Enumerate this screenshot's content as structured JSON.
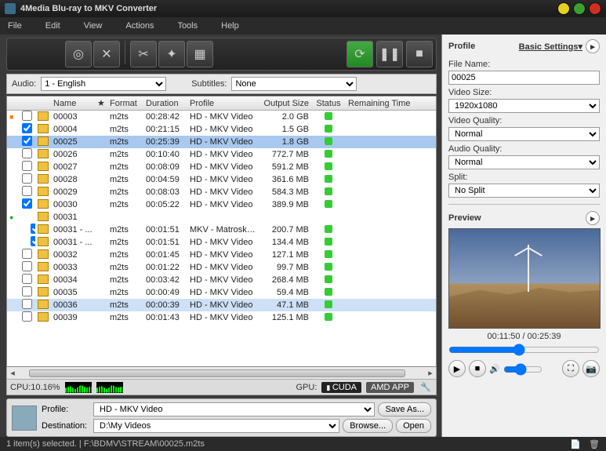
{
  "title": "4Media Blu-ray to MKV Converter",
  "menu": [
    "File",
    "Edit",
    "View",
    "Actions",
    "Tools",
    "Help"
  ],
  "audsub": {
    "audio_label": "Audio:",
    "audio_value": "1 - English",
    "sub_label": "Subtitles:",
    "sub_value": "None"
  },
  "columns": {
    "name": "Name",
    "star": "★",
    "format": "Format",
    "duration": "Duration",
    "profile": "Profile",
    "output": "Output Size",
    "status": "Status",
    "remaining": "Remaining Time"
  },
  "rows": [
    {
      "mark": "orange",
      "checked": false,
      "name": "00003",
      "fmt": "m2ts",
      "dur": "00:28:42",
      "prof": "HD - MKV Video",
      "out": "2.0 GB",
      "stat": true
    },
    {
      "checked": true,
      "name": "00004",
      "fmt": "m2ts",
      "dur": "00:21:15",
      "prof": "HD - MKV Video",
      "out": "1.5 GB",
      "stat": true
    },
    {
      "checked": true,
      "name": "00025",
      "fmt": "m2ts",
      "dur": "00:25:39",
      "prof": "HD - MKV Video",
      "out": "1.8 GB",
      "stat": true,
      "selected": 1
    },
    {
      "checked": false,
      "name": "00026",
      "fmt": "m2ts",
      "dur": "00:10:40",
      "prof": "HD - MKV Video",
      "out": "772.7 MB",
      "stat": true
    },
    {
      "checked": false,
      "name": "00027",
      "fmt": "m2ts",
      "dur": "00:08:09",
      "prof": "HD - MKV Video",
      "out": "591.2 MB",
      "stat": true
    },
    {
      "checked": false,
      "name": "00028",
      "fmt": "m2ts",
      "dur": "00:04:59",
      "prof": "HD - MKV Video",
      "out": "361.6 MB",
      "stat": true
    },
    {
      "checked": false,
      "name": "00029",
      "fmt": "m2ts",
      "dur": "00:08:03",
      "prof": "HD - MKV Video",
      "out": "584.3 MB",
      "stat": true
    },
    {
      "checked": true,
      "name": "00030",
      "fmt": "m2ts",
      "dur": "00:05:22",
      "prof": "HD - MKV Video",
      "out": "389.9 MB",
      "stat": true
    },
    {
      "mark": "green",
      "folder": true,
      "name": "00031"
    },
    {
      "indent": true,
      "checked": true,
      "name": "00031 - ...",
      "fmt": "m2ts",
      "dur": "00:01:51",
      "prof": "MKV - Matroska Vid...",
      "out": "200.7 MB",
      "stat": true
    },
    {
      "indent": true,
      "checked": true,
      "name": "00031 - ...",
      "fmt": "m2ts",
      "dur": "00:01:51",
      "prof": "HD - MKV Video",
      "out": "134.4 MB",
      "stat": true
    },
    {
      "checked": false,
      "name": "00032",
      "fmt": "m2ts",
      "dur": "00:01:45",
      "prof": "HD - MKV Video",
      "out": "127.1 MB",
      "stat": true
    },
    {
      "checked": false,
      "name": "00033",
      "fmt": "m2ts",
      "dur": "00:01:22",
      "prof": "HD - MKV Video",
      "out": "99.7 MB",
      "stat": true
    },
    {
      "checked": false,
      "name": "00034",
      "fmt": "m2ts",
      "dur": "00:03:42",
      "prof": "HD - MKV Video",
      "out": "268.4 MB",
      "stat": true
    },
    {
      "checked": false,
      "name": "00035",
      "fmt": "m2ts",
      "dur": "00:00:49",
      "prof": "HD - MKV Video",
      "out": "59.4 MB",
      "stat": true
    },
    {
      "checked": false,
      "name": "00036",
      "fmt": "m2ts",
      "dur": "00:00:39",
      "prof": "HD - MKV Video",
      "out": "47.1 MB",
      "stat": true,
      "selected": 2
    },
    {
      "checked": false,
      "name": "00039",
      "fmt": "m2ts",
      "dur": "00:01:43",
      "prof": "HD - MKV Video",
      "out": "125.1 MB",
      "stat": true
    }
  ],
  "cpu": {
    "label": "CPU:10.16%",
    "gpu_label": "GPU:",
    "cuda": "CUDA",
    "amd": "AMD",
    "app": "APP"
  },
  "profbox": {
    "profile_label": "Profile:",
    "profile_value": "HD - MKV Video",
    "dest_label": "Destination:",
    "dest_value": "D:\\My Videos",
    "saveas": "Save As...",
    "browse": "Browse...",
    "open": "Open"
  },
  "status": "1 item(s) selected. | F:\\BDMV\\STREAM\\00025.m2ts",
  "profile_panel": {
    "title": "Profile",
    "basic": "Basic Settings▾",
    "filename_label": "File Name:",
    "filename_value": "00025",
    "videosize_label": "Video Size:",
    "videosize_value": "1920x1080",
    "vq_label": "Video Quality:",
    "vq_value": "Normal",
    "aq_label": "Audio Quality:",
    "aq_value": "Normal",
    "split_label": "Split:",
    "split_value": "No Split"
  },
  "preview": {
    "title": "Preview",
    "time": "00:11:50 / 00:25:39"
  }
}
